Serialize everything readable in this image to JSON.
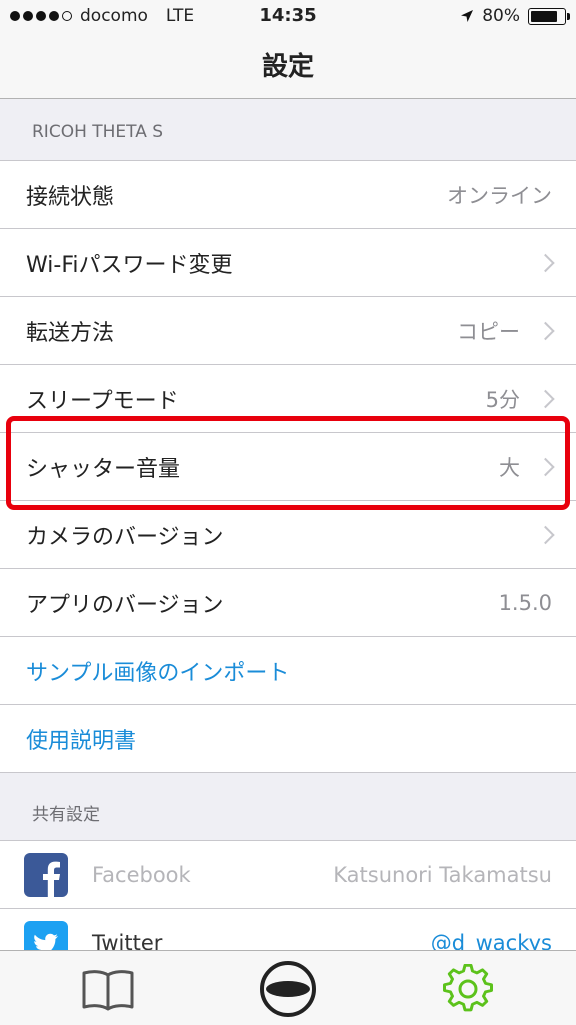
{
  "status_bar": {
    "carrier": "docomo",
    "network": "LTE",
    "time": "14:35",
    "battery": "80%"
  },
  "nav": {
    "title": "設定"
  },
  "section_camera": {
    "header": "RICOH THETA S",
    "rows": [
      {
        "label": "接続状態",
        "value": "オンライン"
      },
      {
        "label": "Wi-Fiパスワード変更",
        "value": ""
      },
      {
        "label": "転送方法",
        "value": "コピー"
      },
      {
        "label": "スリープモード",
        "value": "5分"
      },
      {
        "label": "シャッター音量",
        "value": "大"
      },
      {
        "label": "カメラのバージョン",
        "value": ""
      },
      {
        "label": "アプリのバージョン",
        "value": "1.5.0"
      },
      {
        "label": "サンプル画像のインポート"
      },
      {
        "label": "使用説明書"
      }
    ]
  },
  "section_share": {
    "header": "共有設定",
    "facebook": {
      "name": "Facebook",
      "account": "Katsunori Takamatsu"
    },
    "twitter": {
      "name": "Twitter",
      "account": "@d_wackys"
    }
  },
  "colors": {
    "link": "#1a8cd8",
    "highlight": "#e8000d",
    "settings_active": "#5cc21b"
  },
  "tabs": [
    "book-icon",
    "camera-icon",
    "settings-gear-icon"
  ]
}
